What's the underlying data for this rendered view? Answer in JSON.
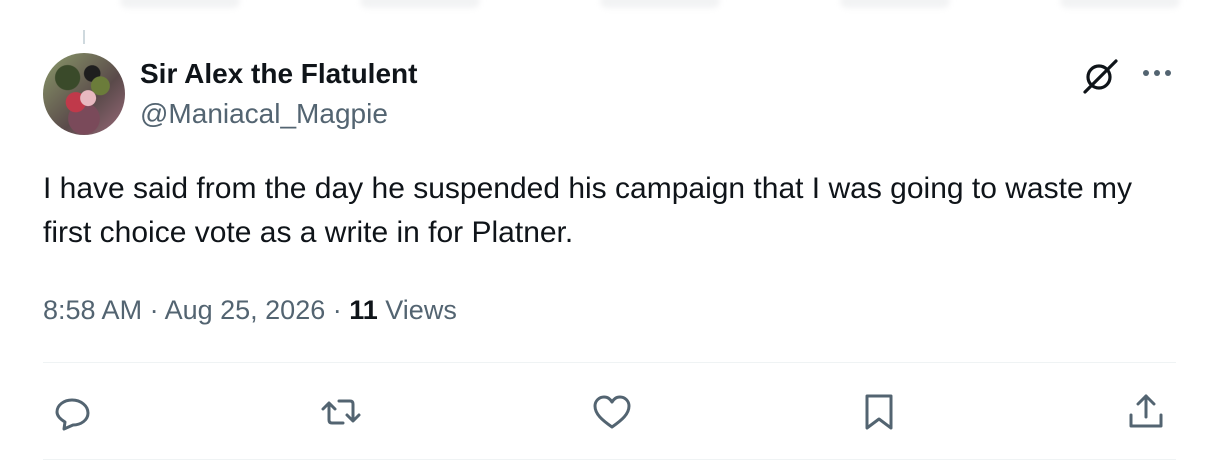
{
  "author": {
    "display_name": "Sir Alex the Flatulent",
    "handle": "@Maniacal_Magpie"
  },
  "tweet": {
    "text": "I have said from the day he suspended his campaign that I was going to waste my first choice vote as a write in for Platner."
  },
  "meta": {
    "time": "8:58 AM",
    "sep1": " · ",
    "date": "Aug 25, 2026",
    "sep2": " · ",
    "views_count": "11",
    "views_label": " Views"
  },
  "icons": {
    "header": [
      "grok-icon",
      "more-icon"
    ],
    "actions": [
      "reply-icon",
      "retweet-icon",
      "like-icon",
      "bookmark-icon",
      "share-icon"
    ]
  },
  "colors": {
    "text": "#0f1419",
    "secondary": "#536471",
    "divider": "#eff3f4"
  }
}
